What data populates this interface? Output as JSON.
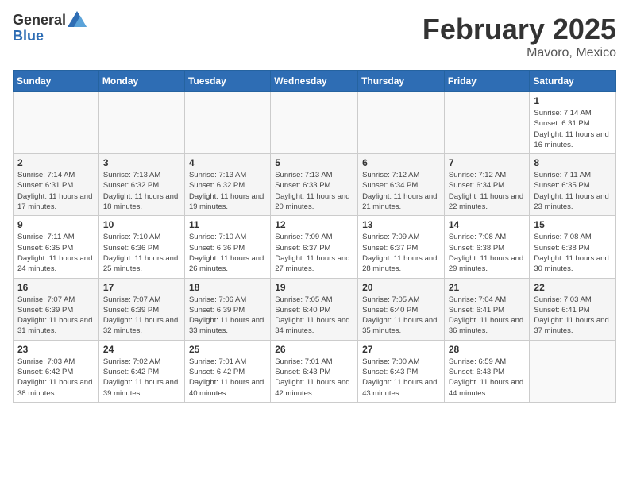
{
  "header": {
    "logo_general": "General",
    "logo_blue": "Blue",
    "month_title": "February 2025",
    "location": "Mavoro, Mexico"
  },
  "days_of_week": [
    "Sunday",
    "Monday",
    "Tuesday",
    "Wednesday",
    "Thursday",
    "Friday",
    "Saturday"
  ],
  "weeks": [
    [
      {
        "day": "",
        "info": ""
      },
      {
        "day": "",
        "info": ""
      },
      {
        "day": "",
        "info": ""
      },
      {
        "day": "",
        "info": ""
      },
      {
        "day": "",
        "info": ""
      },
      {
        "day": "",
        "info": ""
      },
      {
        "day": "1",
        "info": "Sunrise: 7:14 AM\nSunset: 6:31 PM\nDaylight: 11 hours and 16 minutes."
      }
    ],
    [
      {
        "day": "2",
        "info": "Sunrise: 7:14 AM\nSunset: 6:31 PM\nDaylight: 11 hours and 17 minutes."
      },
      {
        "day": "3",
        "info": "Sunrise: 7:13 AM\nSunset: 6:32 PM\nDaylight: 11 hours and 18 minutes."
      },
      {
        "day": "4",
        "info": "Sunrise: 7:13 AM\nSunset: 6:32 PM\nDaylight: 11 hours and 19 minutes."
      },
      {
        "day": "5",
        "info": "Sunrise: 7:13 AM\nSunset: 6:33 PM\nDaylight: 11 hours and 20 minutes."
      },
      {
        "day": "6",
        "info": "Sunrise: 7:12 AM\nSunset: 6:34 PM\nDaylight: 11 hours and 21 minutes."
      },
      {
        "day": "7",
        "info": "Sunrise: 7:12 AM\nSunset: 6:34 PM\nDaylight: 11 hours and 22 minutes."
      },
      {
        "day": "8",
        "info": "Sunrise: 7:11 AM\nSunset: 6:35 PM\nDaylight: 11 hours and 23 minutes."
      }
    ],
    [
      {
        "day": "9",
        "info": "Sunrise: 7:11 AM\nSunset: 6:35 PM\nDaylight: 11 hours and 24 minutes."
      },
      {
        "day": "10",
        "info": "Sunrise: 7:10 AM\nSunset: 6:36 PM\nDaylight: 11 hours and 25 minutes."
      },
      {
        "day": "11",
        "info": "Sunrise: 7:10 AM\nSunset: 6:36 PM\nDaylight: 11 hours and 26 minutes."
      },
      {
        "day": "12",
        "info": "Sunrise: 7:09 AM\nSunset: 6:37 PM\nDaylight: 11 hours and 27 minutes."
      },
      {
        "day": "13",
        "info": "Sunrise: 7:09 AM\nSunset: 6:37 PM\nDaylight: 11 hours and 28 minutes."
      },
      {
        "day": "14",
        "info": "Sunrise: 7:08 AM\nSunset: 6:38 PM\nDaylight: 11 hours and 29 minutes."
      },
      {
        "day": "15",
        "info": "Sunrise: 7:08 AM\nSunset: 6:38 PM\nDaylight: 11 hours and 30 minutes."
      }
    ],
    [
      {
        "day": "16",
        "info": "Sunrise: 7:07 AM\nSunset: 6:39 PM\nDaylight: 11 hours and 31 minutes."
      },
      {
        "day": "17",
        "info": "Sunrise: 7:07 AM\nSunset: 6:39 PM\nDaylight: 11 hours and 32 minutes."
      },
      {
        "day": "18",
        "info": "Sunrise: 7:06 AM\nSunset: 6:39 PM\nDaylight: 11 hours and 33 minutes."
      },
      {
        "day": "19",
        "info": "Sunrise: 7:05 AM\nSunset: 6:40 PM\nDaylight: 11 hours and 34 minutes."
      },
      {
        "day": "20",
        "info": "Sunrise: 7:05 AM\nSunset: 6:40 PM\nDaylight: 11 hours and 35 minutes."
      },
      {
        "day": "21",
        "info": "Sunrise: 7:04 AM\nSunset: 6:41 PM\nDaylight: 11 hours and 36 minutes."
      },
      {
        "day": "22",
        "info": "Sunrise: 7:03 AM\nSunset: 6:41 PM\nDaylight: 11 hours and 37 minutes."
      }
    ],
    [
      {
        "day": "23",
        "info": "Sunrise: 7:03 AM\nSunset: 6:42 PM\nDaylight: 11 hours and 38 minutes."
      },
      {
        "day": "24",
        "info": "Sunrise: 7:02 AM\nSunset: 6:42 PM\nDaylight: 11 hours and 39 minutes."
      },
      {
        "day": "25",
        "info": "Sunrise: 7:01 AM\nSunset: 6:42 PM\nDaylight: 11 hours and 40 minutes."
      },
      {
        "day": "26",
        "info": "Sunrise: 7:01 AM\nSunset: 6:43 PM\nDaylight: 11 hours and 42 minutes."
      },
      {
        "day": "27",
        "info": "Sunrise: 7:00 AM\nSunset: 6:43 PM\nDaylight: 11 hours and 43 minutes."
      },
      {
        "day": "28",
        "info": "Sunrise: 6:59 AM\nSunset: 6:43 PM\nDaylight: 11 hours and 44 minutes."
      },
      {
        "day": "",
        "info": ""
      }
    ]
  ]
}
